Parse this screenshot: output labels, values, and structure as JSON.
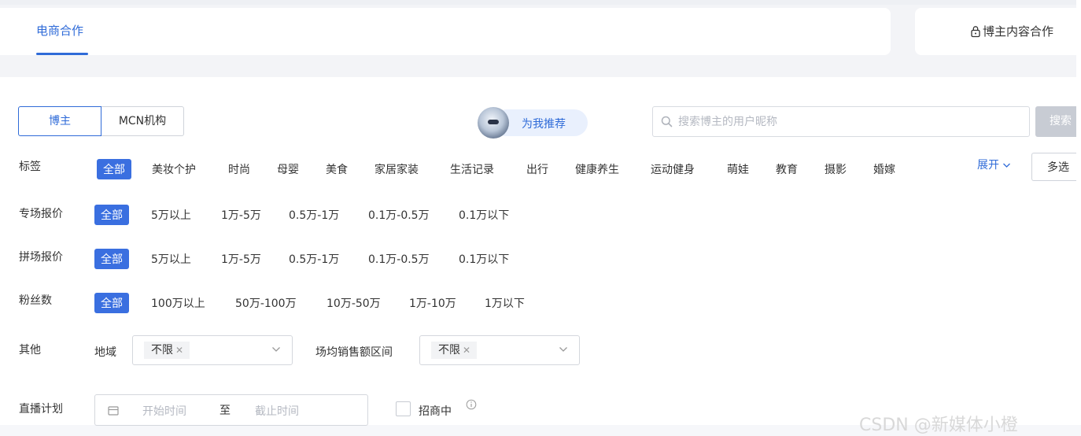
{
  "tabs": {
    "ecommerce": "电商合作",
    "creator_content": "博主内容合作"
  },
  "segment": {
    "blogger": "博主",
    "mcn": "MCN机构"
  },
  "recommend": {
    "label": "为我推荐"
  },
  "search": {
    "placeholder": "搜索博主的用户昵称",
    "button": "搜索"
  },
  "filters": {
    "tags": {
      "label": "标签",
      "options": [
        "全部",
        "美妆个护",
        "时尚",
        "母婴",
        "美食",
        "家居家装",
        "生活记录",
        "出行",
        "健康养生",
        "运动健身",
        "萌娃",
        "教育",
        "摄影",
        "婚嫁"
      ],
      "selected": "全部",
      "expand": "展开",
      "multi": "多选"
    },
    "special_price": {
      "label": "专场报价",
      "options": [
        "全部",
        "5万以上",
        "1万-5万",
        "0.5万-1万",
        "0.1万-0.5万",
        "0.1万以下"
      ],
      "selected": "全部"
    },
    "combined_price": {
      "label": "拼场报价",
      "options": [
        "全部",
        "5万以上",
        "1万-5万",
        "0.5万-1万",
        "0.1万-0.5万",
        "0.1万以下"
      ],
      "selected": "全部"
    },
    "fans": {
      "label": "粉丝数",
      "options": [
        "全部",
        "100万以上",
        "50万-100万",
        "10万-50万",
        "1万-10万",
        "1万以下"
      ],
      "selected": "全部"
    },
    "other": {
      "label": "其他",
      "region_label": "地域",
      "region_value": "不限",
      "sales_label": "场均销售额区间",
      "sales_value": "不限"
    },
    "live_plan": {
      "label": "直播计划",
      "start_placeholder": "开始时间",
      "separator": "至",
      "end_placeholder": "截止时间",
      "checkbox_label": "招商中"
    }
  },
  "watermark": "CSDN @新媒体小橙",
  "colors": {
    "accent": "#2f6bd8",
    "active_chip": "#3a6fe0"
  }
}
